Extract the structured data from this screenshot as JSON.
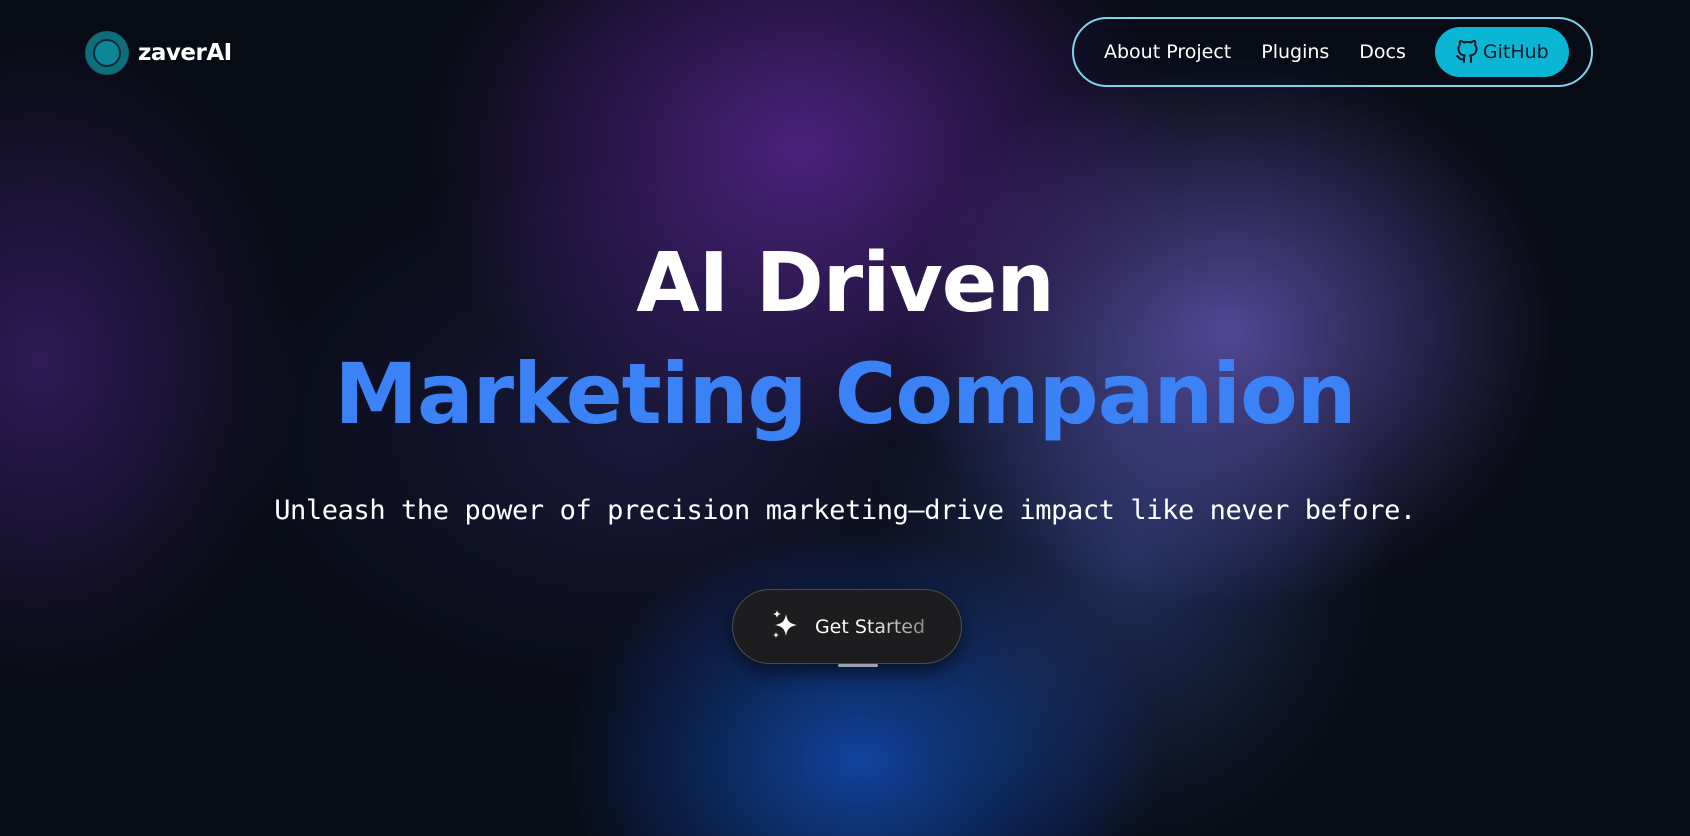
{
  "brand": {
    "name": "zaverAI",
    "logo_icon": "circle-logo-icon",
    "accent_color": "#0ab6d4"
  },
  "nav": {
    "items": [
      {
        "label": "About Project"
      },
      {
        "label": "Plugins"
      },
      {
        "label": "Docs"
      }
    ],
    "github": {
      "label": "GitHub",
      "icon": "github-icon"
    },
    "border_color": "#7fd3ee"
  },
  "hero": {
    "title_line1": "AI Driven",
    "title_line2": "Marketing Companion",
    "title_line2_color": "#3b82f6",
    "subtitle": "Unleash the power of precision marketing—drive impact like never before."
  },
  "cta": {
    "label": "Get Started",
    "icon": "sparkles-icon"
  }
}
